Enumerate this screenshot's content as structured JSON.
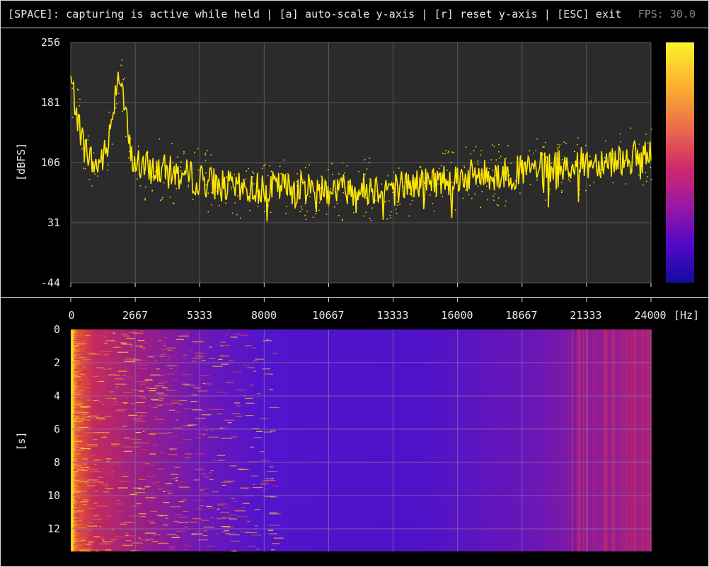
{
  "topbar": {
    "help_text": "[SPACE]: capturing is active while held | [a] auto-scale y-axis | [r] reset y-axis | [ESC] exit",
    "fps_text": "FPS: 30.0"
  },
  "spectrum": {
    "ylabel": "[dBFS]",
    "yticks": [
      "256",
      "181",
      "106",
      "31",
      "-44"
    ],
    "ylim": [
      -44,
      256
    ],
    "colorbar_colors": [
      "#fcef30",
      "#f89a3a",
      "#d5416a",
      "#8a1ca0",
      "#2b0bb0",
      "#0d0887"
    ]
  },
  "freq_axis": {
    "ticks": [
      "0",
      "2667",
      "5333",
      "8000",
      "10667",
      "13333",
      "16000",
      "18667",
      "21333",
      "24000"
    ],
    "unit": "[Hz]"
  },
  "spectrogram": {
    "ylabel": "[s]",
    "yticks": [
      "0",
      "2",
      "4",
      "6",
      "8",
      "10",
      "12"
    ]
  },
  "chart_data": [
    {
      "type": "line",
      "ylabel": "[dBFS]",
      "xlim": [
        0,
        24000
      ],
      "ylim": [
        -44,
        256
      ],
      "x": [
        0,
        500,
        1000,
        1500,
        2000,
        2500,
        3000,
        4000,
        5000,
        6000,
        7000,
        8000,
        10000,
        12000,
        14000,
        16000,
        18000,
        20000,
        22000,
        24000
      ],
      "series": [
        {
          "values": [
            210,
            130,
            100,
            120,
            230,
            110,
            100,
            95,
            88,
            80,
            72,
            75,
            75,
            73,
            78,
            88,
            92,
            100,
            108,
            115
          ]
        }
      ],
      "grid": true
    },
    {
      "type": "heatmap",
      "ylabel": "[s]",
      "xlim": [
        0,
        24000
      ],
      "ylim": [
        0,
        13.4
      ]
    }
  ]
}
